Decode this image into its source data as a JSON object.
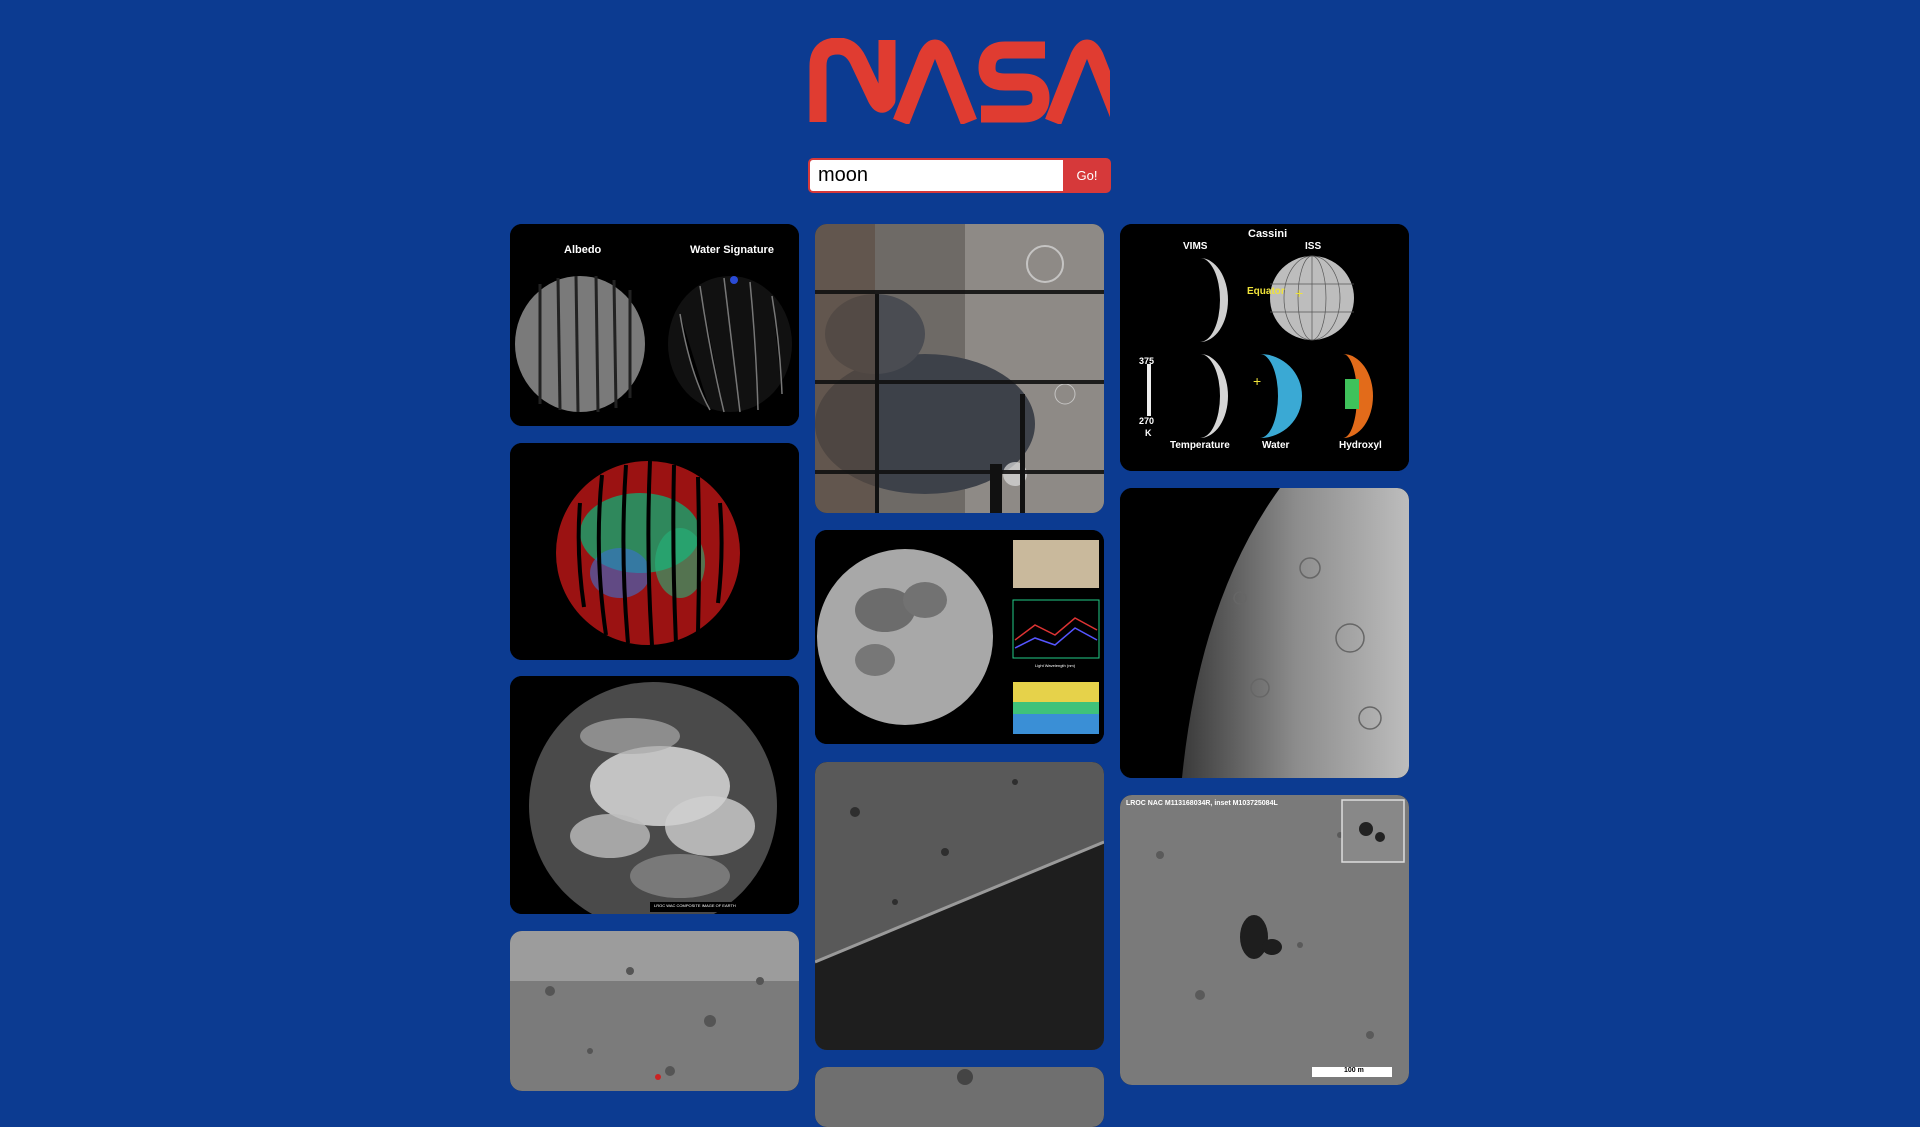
{
  "logo": {
    "text": "NASA",
    "color": "#e03c31"
  },
  "search": {
    "value": "moon",
    "button_label": "Go!"
  },
  "colors": {
    "background": "#0c3b91",
    "accent": "#d6393a"
  },
  "results": {
    "albedo_water": {
      "labels": [
        "Albedo",
        "Water Signature"
      ]
    },
    "cassini": {
      "title": "Cassini",
      "labels": [
        "VIMS",
        "ISS",
        "Equator",
        "375",
        "270",
        "K",
        "Temperature",
        "Water",
        "Hydroxyl"
      ]
    },
    "spectra": {
      "xlabel": "Light Wavelength (nm)"
    },
    "earth": {
      "caption": "LROC WAC COMPOSITE IMAGE OF EARTH"
    },
    "lroc_nac": {
      "caption": "LROC NAC M113168034R, inset M103725084L",
      "scale": "100 m"
    }
  }
}
